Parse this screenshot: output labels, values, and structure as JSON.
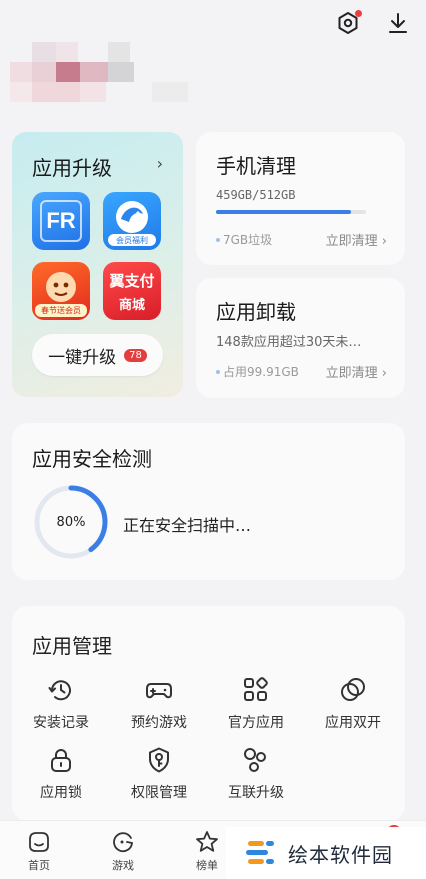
{
  "upgrade": {
    "title": "应用升级",
    "apps": [
      {
        "name": "fr-app-icon",
        "text": "FR"
      },
      {
        "name": "dolphin-app-icon",
        "text": "会员福利"
      },
      {
        "name": "uc-app-icon",
        "text": "春节送会员"
      },
      {
        "name": "yipay-app-icon",
        "text": "翼支付",
        "subtext": "商城"
      }
    ],
    "button_label": "一键升级",
    "badge": "78"
  },
  "cleanup": {
    "title": "手机清理",
    "storage": "459GB/512GB",
    "progress": 0.9,
    "junk": "7GB垃圾",
    "action": "立即清理 ›"
  },
  "uninstall": {
    "title": "应用卸载",
    "subtitle": "148款应用超过30天未…",
    "occupied": "占用99.91GB",
    "action": "立即清理 ›"
  },
  "security": {
    "title": "应用安全检测",
    "percent": "80%",
    "progress": 0.8,
    "status": "正在安全扫描中…"
  },
  "manage": {
    "title": "应用管理",
    "items": [
      {
        "name": "install-history",
        "label": "安装记录",
        "icon": "clock-history-icon"
      },
      {
        "name": "reserve-games",
        "label": "预约游戏",
        "icon": "gamepad-icon"
      },
      {
        "name": "official-apps",
        "label": "官方应用",
        "icon": "grid-apps-icon"
      },
      {
        "name": "dual-apps",
        "label": "应用双开",
        "icon": "dual-circle-icon"
      },
      {
        "name": "app-lock",
        "label": "应用锁",
        "icon": "lock-icon"
      },
      {
        "name": "permissions",
        "label": "权限管理",
        "icon": "shield-key-icon"
      },
      {
        "name": "mutual-upgrade",
        "label": "互联升级",
        "icon": "connected-circles-icon"
      }
    ]
  },
  "nav": {
    "items": [
      {
        "label": "首页",
        "icon": "home-smile-icon"
      },
      {
        "label": "游戏",
        "icon": "game-icon"
      },
      {
        "label": "榜单",
        "icon": "star-icon"
      }
    ]
  },
  "watermark": {
    "text": "绘本软件园"
  },
  "colors": {
    "accent": "#3a7ee6",
    "badge": "#e43d3d",
    "page_bg": "#f3f3f5"
  }
}
